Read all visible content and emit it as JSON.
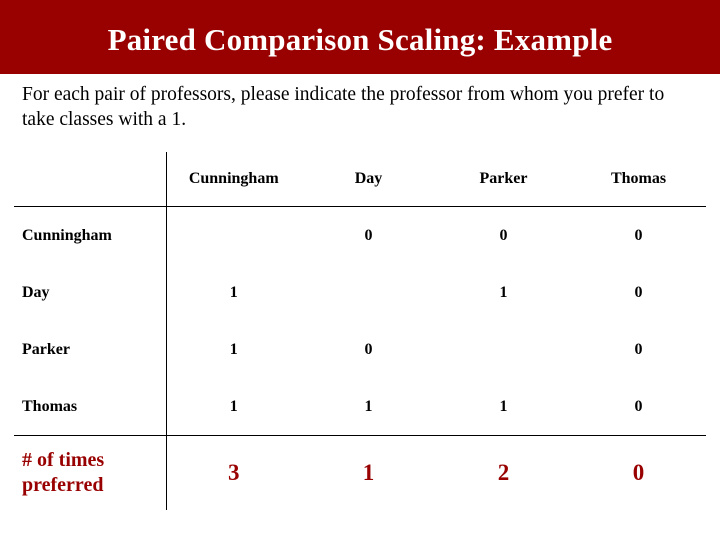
{
  "slide": {
    "title": "Paired Comparison Scaling: Example",
    "title_bg": "#990000",
    "title_color": "#ffffff",
    "intro": "For each pair of professors, please indicate the professor from whom you prefer to take classes with a 1.",
    "accent_color": "#990000"
  },
  "table": {
    "corner_label": "",
    "columns": [
      "Cunningham",
      "Day",
      "Parker",
      "Thomas"
    ],
    "rows": [
      {
        "label": "Cunningham",
        "cells": [
          "",
          "0",
          "0",
          "0"
        ]
      },
      {
        "label": "Day",
        "cells": [
          "1",
          "",
          "1",
          "0"
        ]
      },
      {
        "label": "Parker",
        "cells": [
          "1",
          "0",
          "",
          "0"
        ]
      },
      {
        "label": "Thomas",
        "cells": [
          "1",
          "1",
          "1",
          "0"
        ]
      }
    ],
    "total": {
      "label_line1": "# of times",
      "label_line2": "preferred",
      "cells": [
        "3",
        "1",
        "2",
        "0"
      ]
    }
  }
}
